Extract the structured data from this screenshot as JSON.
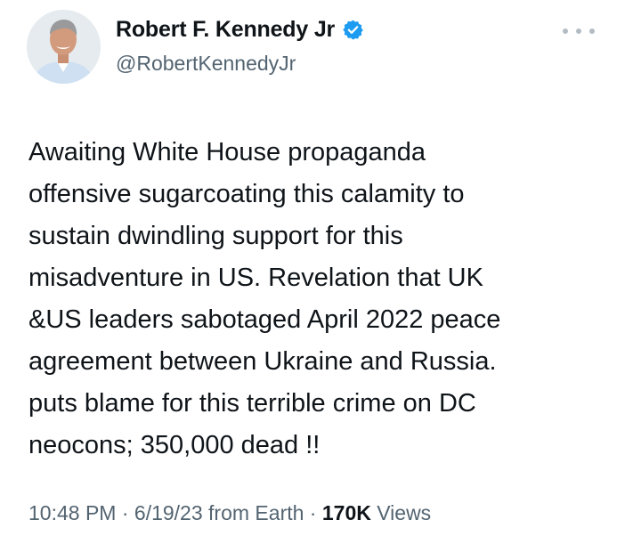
{
  "tweet": {
    "author_name": "Robert F. Kennedy Jr",
    "author_handle": "@RobertKennedyJr",
    "verified_color": "#1d9bf0",
    "text": "Awaiting White House propaganda\noffensive sugarcoating this calamity to\nsustain dwindling support for this\nmisadventure in US. Revelation that UK\n&US leaders sabotaged April 2022 peace\nagreement between Ukraine and Russia.\nputs blame for this terrible crime on DC\nneocons; 350,000 dead !!",
    "time": "10:48 PM",
    "date": "6/19/23",
    "source": "from Earth",
    "views_count": "170K",
    "views_label": "Views",
    "separator": " · "
  },
  "icons": {
    "avatar": "profile-photo",
    "verified": "verified-badge-icon",
    "more": "more-options-icon"
  }
}
